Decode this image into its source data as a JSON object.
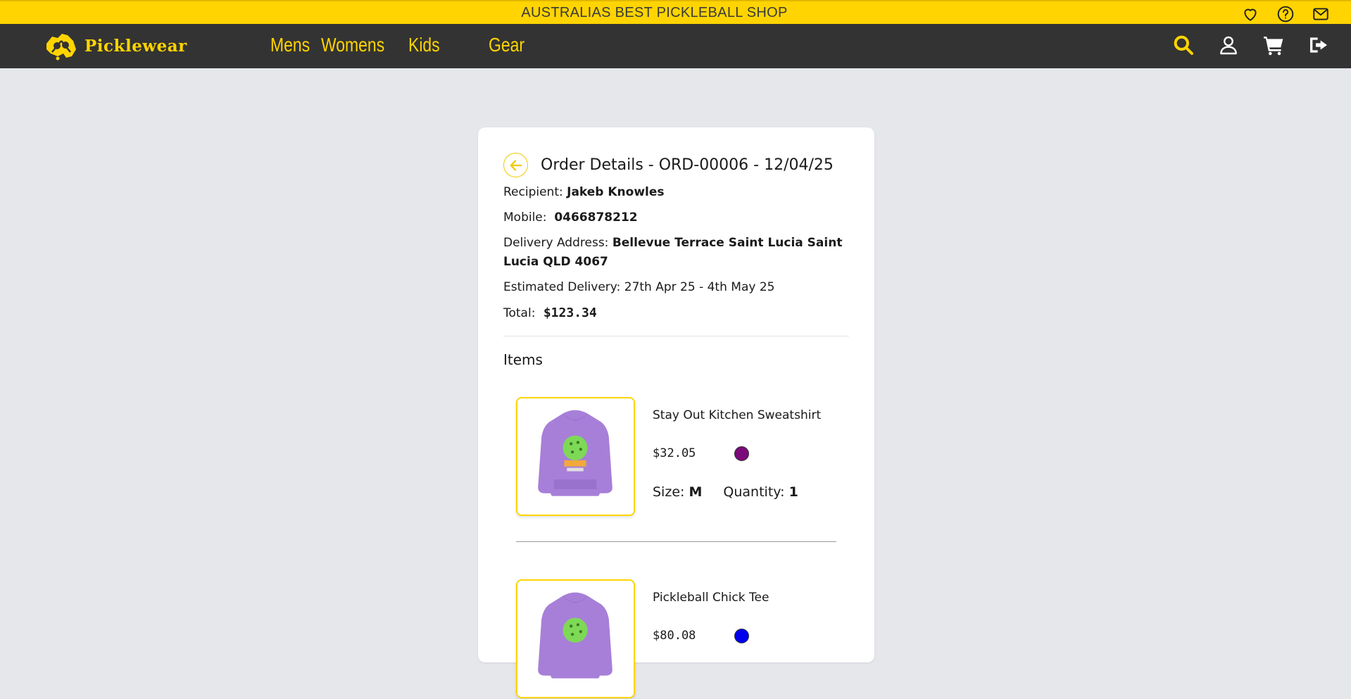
{
  "announcement": "AUSTRALIAS BEST PICKLEBALL SHOP",
  "topbar_icons": [
    "heart-icon",
    "help-icon",
    "mail-icon"
  ],
  "brand": {
    "name": "Picklewear"
  },
  "nav": {
    "links": [
      "Mens",
      "Womens",
      "Kids",
      "Gear"
    ],
    "right_icons": [
      "search-icon",
      "user-icon",
      "cart-icon",
      "logout-icon"
    ]
  },
  "colors": {
    "brand_yellow": "#ffd400",
    "nav_bg": "#333333",
    "page_bg": "#e5e7eb"
  },
  "order": {
    "title": "Order Details - ORD-00006 - 12/04/25",
    "recipient_label": "Recipient:",
    "recipient": "Jakeb Knowles",
    "mobile_label": "Mobile:",
    "mobile": "0466878212",
    "address_label": "Delivery Address:",
    "address": "Bellevue Terrace Saint Lucia Saint Lucia QLD 4067",
    "estimated_label": "Estimated Delivery:",
    "estimated": "27th Apr 25 - 4th May 25",
    "total_label": "Total:",
    "total": "$123.34",
    "items_heading": "Items",
    "items": [
      {
        "name": "Stay Out Kitchen Sweatshirt",
        "price": "$32.05",
        "color": "#7a0a7a",
        "size_label": "Size:",
        "size": "M",
        "quantity_label": "Quantity:",
        "quantity": "1"
      },
      {
        "name": "Pickleball Chick Tee",
        "price": "$80.08",
        "color": "#0000ee"
      }
    ]
  }
}
